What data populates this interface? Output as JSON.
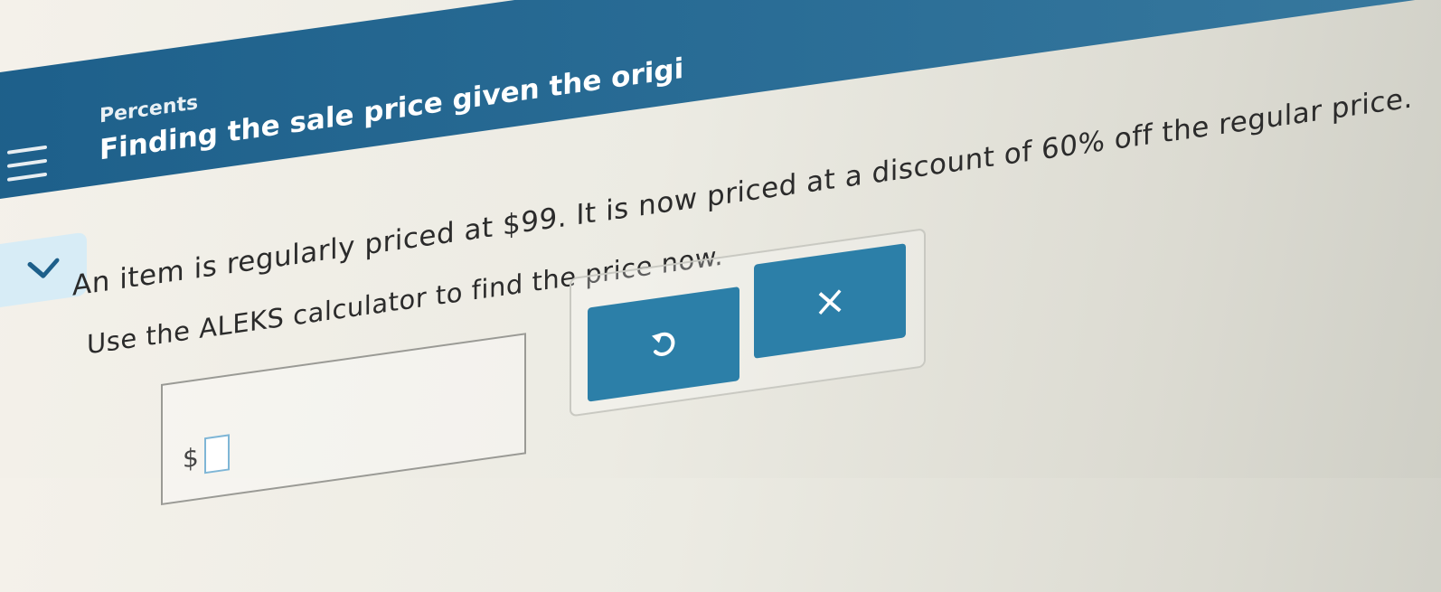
{
  "header": {
    "subject": "Percents",
    "topic": "Finding the sale price given the origi"
  },
  "question": {
    "line1": "An item is regularly priced at $99. It is now priced at a discount of 60% off the regular price.",
    "line2": "Use the ALEKS calculator to find the price now."
  },
  "answer": {
    "currency_symbol": "$",
    "value": ""
  },
  "buttons": {
    "undo_icon": "undo-icon",
    "clear_label": "×"
  },
  "colors": {
    "header": "#2a6d96",
    "button": "#2c7fa8",
    "chevron_tab": "#d7ecf6"
  }
}
